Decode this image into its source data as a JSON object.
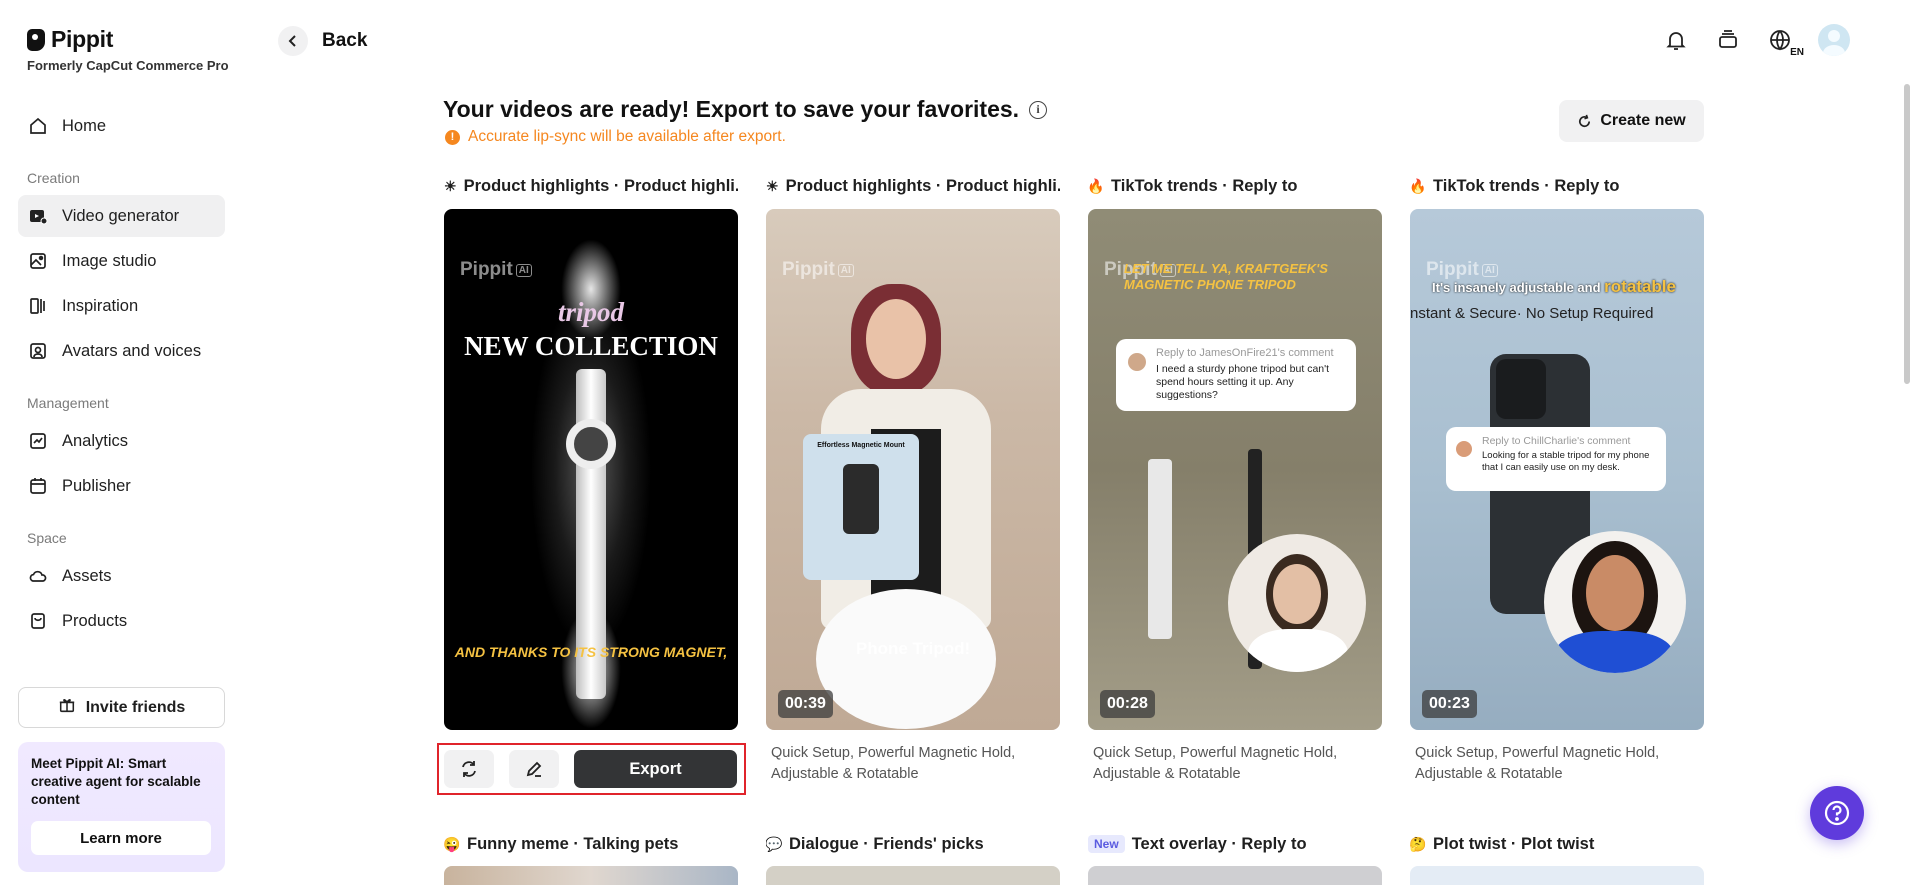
{
  "brand": {
    "name": "Pippit",
    "subtitle": "Formerly CapCut Commerce Pro"
  },
  "sidebar": {
    "items": [
      {
        "label": "Home",
        "icon": "home-icon"
      },
      {
        "section": "Creation"
      },
      {
        "label": "Video generator",
        "icon": "video-icon",
        "active": true
      },
      {
        "label": "Image studio",
        "icon": "image-icon"
      },
      {
        "label": "Inspiration",
        "icon": "inspiration-icon"
      },
      {
        "label": "Avatars and voices",
        "icon": "avatar-icon"
      },
      {
        "section": "Management"
      },
      {
        "label": "Analytics",
        "icon": "analytics-icon"
      },
      {
        "label": "Publisher",
        "icon": "calendar-icon"
      },
      {
        "section": "Space"
      },
      {
        "label": "Assets",
        "icon": "cloud-icon"
      },
      {
        "label": "Products",
        "icon": "product-icon"
      }
    ],
    "sections": {
      "creation": "Creation",
      "management": "Management",
      "space": "Space"
    },
    "labels": {
      "home": "Home",
      "video_generator": "Video generator",
      "image_studio": "Image studio",
      "inspiration": "Inspiration",
      "avatars": "Avatars and voices",
      "analytics": "Analytics",
      "publisher": "Publisher",
      "assets": "Assets",
      "products": "Products"
    },
    "invite_label": "Invite friends",
    "promo": {
      "text": "Meet Pippit AI: Smart creative agent for scalable content",
      "button": "Learn more"
    }
  },
  "topbar": {
    "back_label": "Back",
    "lang": "EN"
  },
  "main": {
    "title": "Your videos are ready! Export to save your favorites.",
    "warning": "Accurate lip-sync will be available after export.",
    "create_new": "Create new",
    "cards": [
      {
        "emoji": "☀",
        "title": "Product highlights · Product highli...",
        "desc": "",
        "duration": "",
        "overlay_top": "tripod",
        "overlay_main": "NEW COLLECTION",
        "overlay_bottom": "AND THANKS TO ITS STRONG MAGNET,"
      },
      {
        "emoji": "☀",
        "title": "Product highlights · Product highli...",
        "desc": "Quick Setup, Powerful Magnetic Hold, Adjustable & Rotatable",
        "duration": "00:39",
        "overlay_bottom": "Phone Tripod!",
        "inset_title": "Effortless Magnetic Mount"
      },
      {
        "emoji": "🔥",
        "title": "TikTok trends · Reply to",
        "desc": "Quick Setup, Powerful Magnetic Hold, Adjustable & Rotatable",
        "duration": "00:28",
        "overlay_caption": "LET ME TELL YA, KRAFTGEEK'S MAGNETIC PHONE TRIPOD",
        "reply_to": "Reply to JamesOnFire21's comment",
        "reply_text": "I need a sturdy phone tripod but can't spend hours setting it up. Any suggestions?"
      },
      {
        "emoji": "🔥",
        "title": "TikTok trends · Reply to",
        "desc": "Quick Setup, Powerful Magnetic Hold, Adjustable & Rotatable",
        "duration": "00:23",
        "overlay_caption_a": "It's insanely adjustable and",
        "overlay_caption_b": "rotatable",
        "overlay_caption_c": "nstant & Secure· No Setup Required",
        "reply_to": "Reply to ChillCharlie's comment",
        "reply_text": "Looking for a stable tripod for my phone that I can easily use on my desk."
      }
    ],
    "actions": {
      "export": "Export"
    },
    "watermark": {
      "name": "Pippit",
      "ai": "AI"
    },
    "next_row": [
      {
        "emoji": "😜",
        "title": "Funny meme · Talking pets"
      },
      {
        "emoji": "💬",
        "title": "Dialogue · Friends' picks"
      },
      {
        "badge": "New",
        "title": "Text overlay · Reply to"
      },
      {
        "emoji": "🤔",
        "title": "Plot twist · Plot twist"
      }
    ]
  },
  "colors": {
    "accent": "#5f3bdc",
    "warning": "#f5871f",
    "export_bg": "#333436",
    "highlight_border": "#e0242b"
  }
}
